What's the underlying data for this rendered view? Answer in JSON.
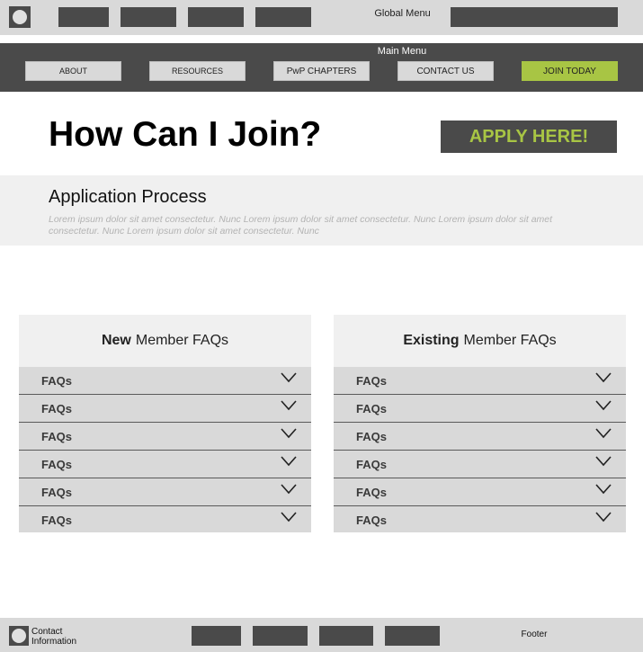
{
  "global_menu": {
    "label": "Global Menu"
  },
  "main_menu": {
    "label": "Main Menu",
    "items": [
      "ABOUT",
      "RESOURCES",
      "PwP CHAPTERS",
      "CONTACT US",
      "JOIN TODAY"
    ]
  },
  "hero": {
    "title": "How Can I Join?",
    "apply_label": "APPLY HERE!"
  },
  "process": {
    "title": "Application Process",
    "text": "Lorem ipsum dolor sit amet consectetur. Nunc  Lorem ipsum dolor sit amet consectetur. Nunc  Lorem ipsum dolor sit amet consectetur. Nunc   Lorem ipsum dolor sit amet consectetur. Nunc"
  },
  "faq_new": {
    "title_bold": "New",
    "title_rest": "Member FAQs",
    "items": [
      "FAQs",
      "FAQs",
      "FAQs",
      "FAQs",
      "FAQs",
      "FAQs"
    ]
  },
  "faq_existing": {
    "title_bold": "Existing",
    "title_rest": "Member FAQs",
    "items": [
      "FAQs",
      "FAQs",
      "FAQs",
      "FAQs",
      "FAQs",
      "FAQs"
    ]
  },
  "footer": {
    "contact_line1": "Contact",
    "contact_line2": "Information",
    "label": "Footer"
  },
  "colors": {
    "dark": "#4a4a4a",
    "light": "#d9d9d9",
    "accent": "#a8c544"
  },
  "icons": {
    "logo": "logo-icon",
    "faq_toggle": "chevron-down-icon"
  }
}
